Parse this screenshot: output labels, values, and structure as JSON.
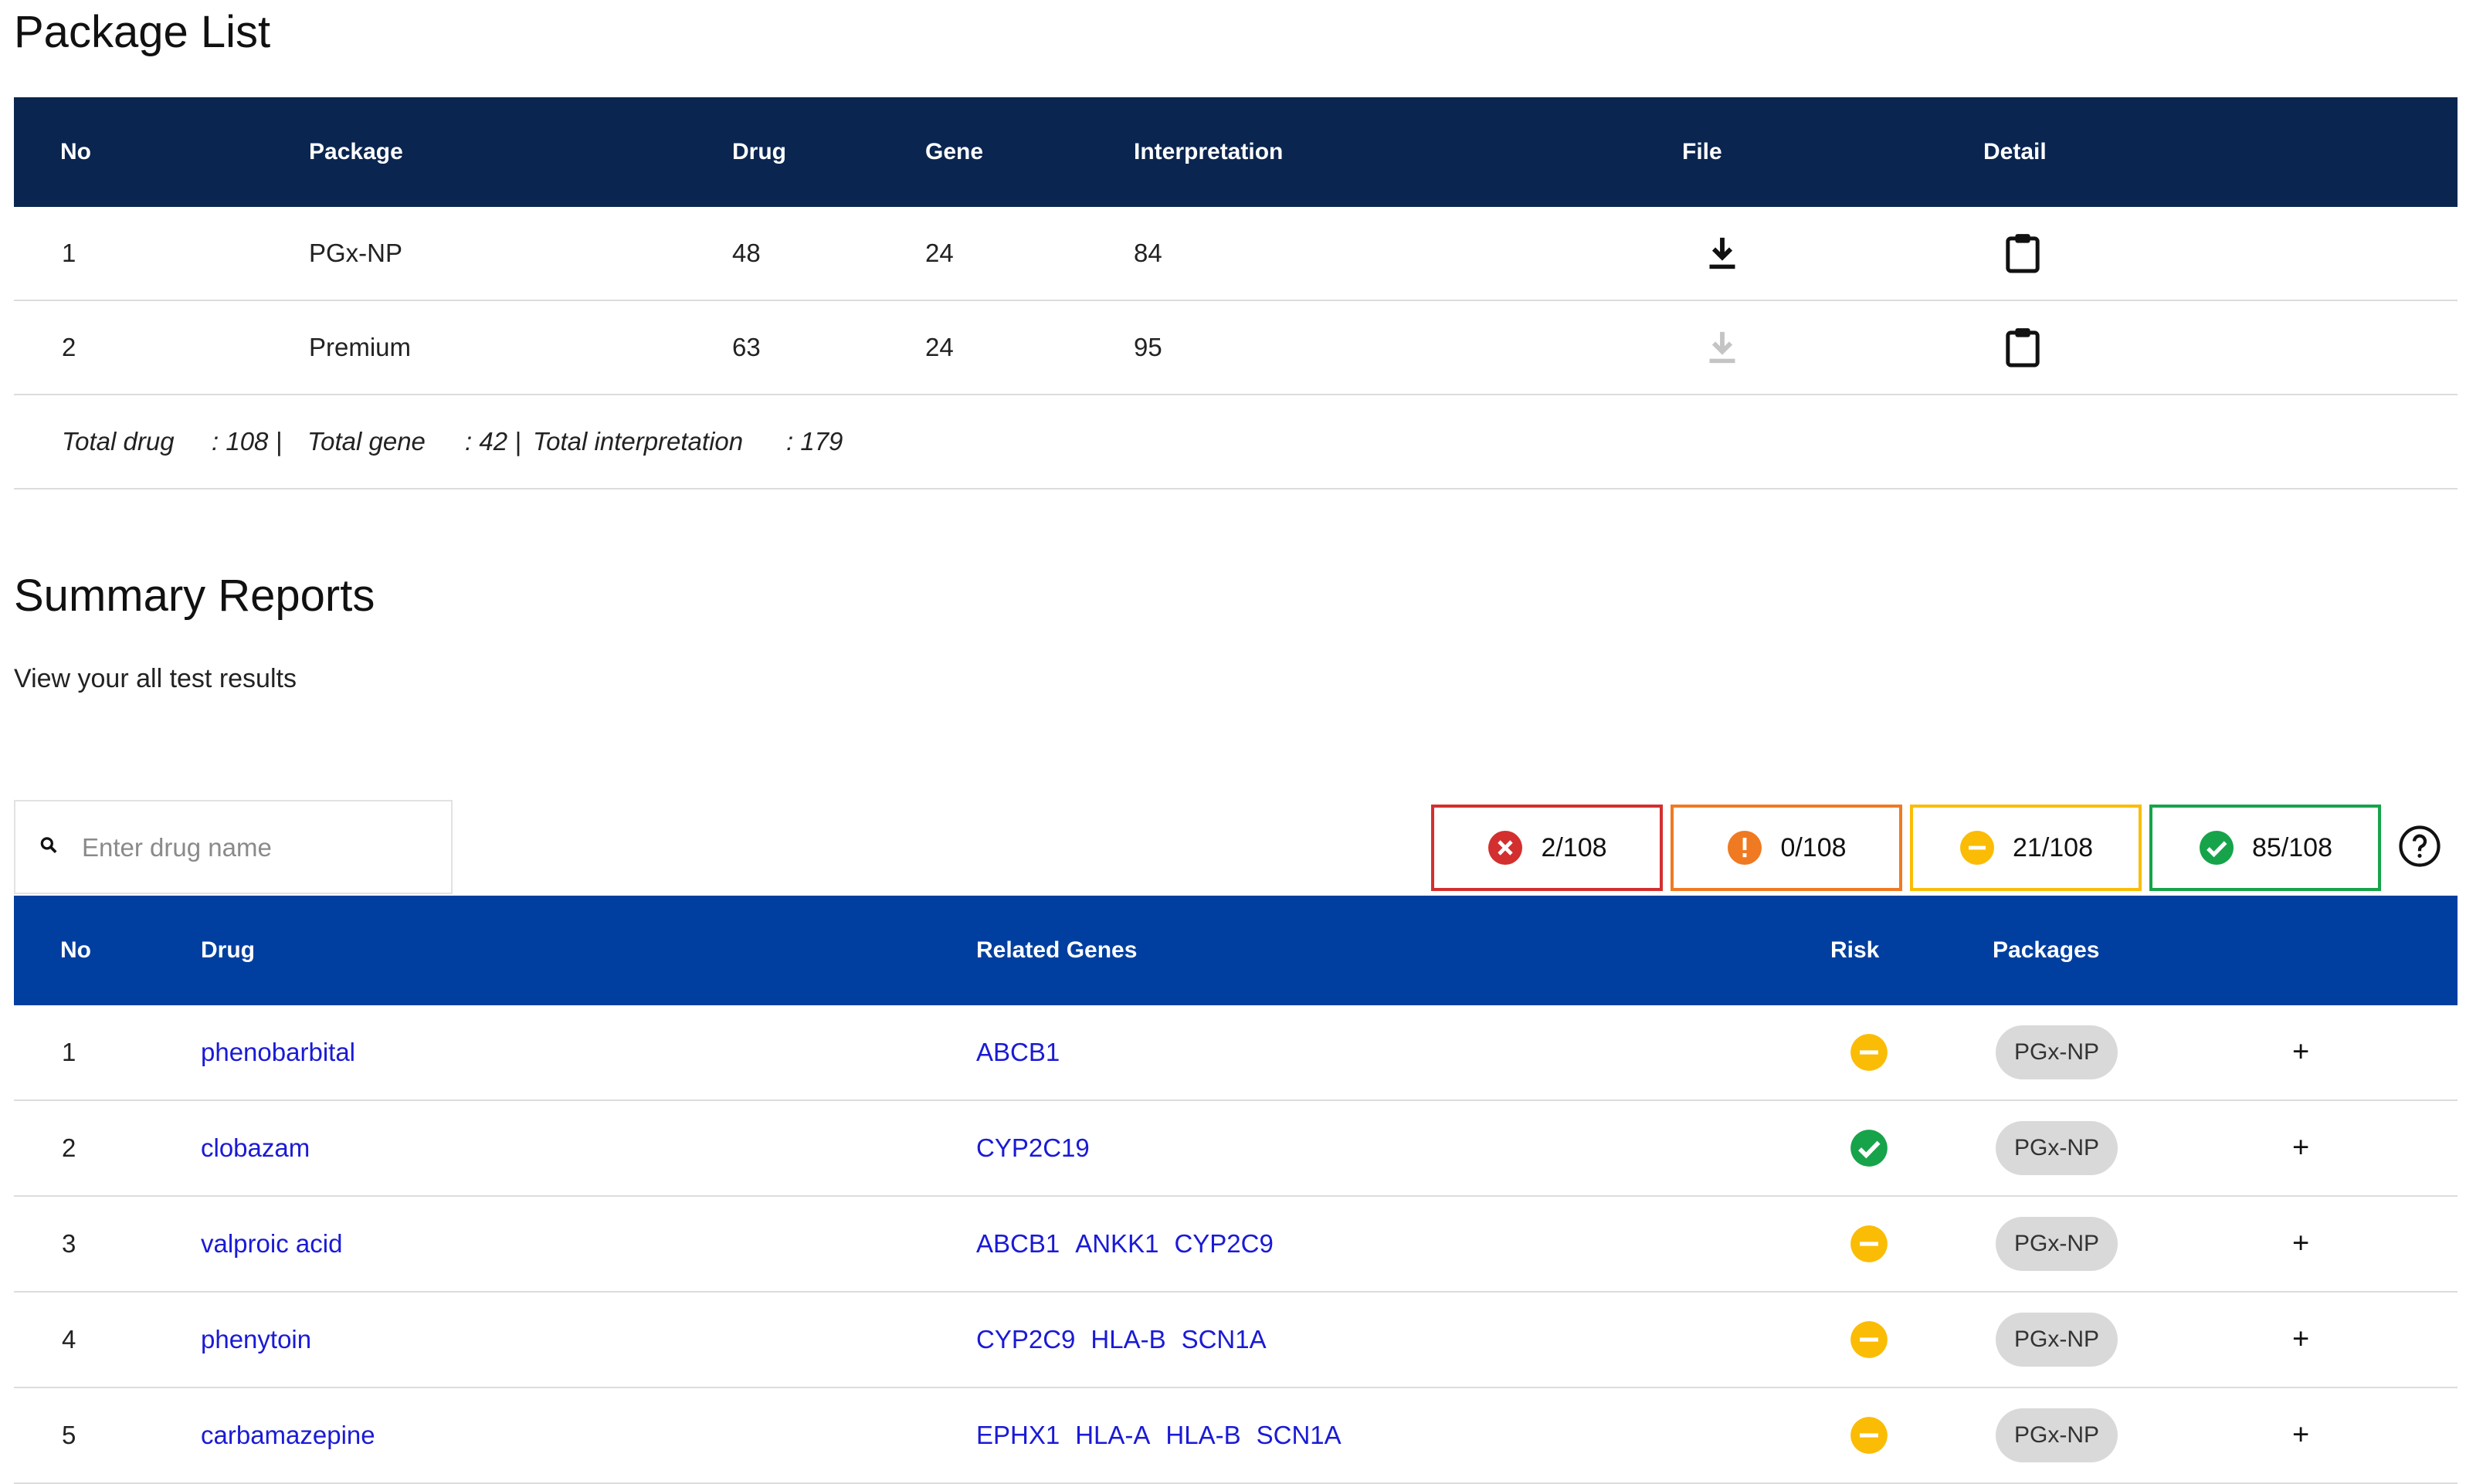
{
  "package_list": {
    "title": "Package List",
    "headers": [
      "No",
      "Package",
      "Drug",
      "Gene",
      "Interpretation",
      "File",
      "Detail"
    ],
    "rows": [
      {
        "no": "1",
        "package": "PGx-NP",
        "drug": "48",
        "gene": "24",
        "interpretation": "84",
        "file_enabled": true
      },
      {
        "no": "2",
        "package": "Premium",
        "drug": "63",
        "gene": "24",
        "interpretation": "95",
        "file_enabled": false
      }
    ],
    "totals": {
      "drug_label": "Total drug",
      "drug_value": ": 108 |",
      "gene_label": "Total gene",
      "gene_value": ": 42 |",
      "interp_label": "Total interpretation",
      "interp_value": ": 179"
    }
  },
  "summary": {
    "title": "Summary Reports",
    "subtitle": "View your all test results",
    "search": {
      "placeholder": "Enter drug name",
      "value": ""
    },
    "counters": [
      {
        "label": "2/108",
        "icon": "x-circle-icon",
        "color": "#d32f2f"
      },
      {
        "label": "0/108",
        "icon": "exclamation-circle-icon",
        "color": "#ef7a22"
      },
      {
        "label": "21/108",
        "icon": "minus-circle-icon",
        "color": "#fbbc05"
      },
      {
        "label": "85/108",
        "icon": "check-circle-icon",
        "color": "#17a34a"
      }
    ],
    "headers": [
      "No",
      "Drug",
      "Related Genes",
      "Risk",
      "Packages"
    ],
    "rows": [
      {
        "no": "1",
        "drug": "phenobarbital",
        "genes": [
          "ABCB1"
        ],
        "risk": "caution",
        "package": "PGx-NP"
      },
      {
        "no": "2",
        "drug": "clobazam",
        "genes": [
          "CYP2C19"
        ],
        "risk": "normal",
        "package": "PGx-NP"
      },
      {
        "no": "3",
        "drug": "valproic acid",
        "genes": [
          "ABCB1",
          "ANKK1",
          "CYP2C9"
        ],
        "risk": "caution",
        "package": "PGx-NP"
      },
      {
        "no": "4",
        "drug": "phenytoin",
        "genes": [
          "CYP2C9",
          "HLA-B",
          "SCN1A"
        ],
        "risk": "caution",
        "package": "PGx-NP"
      },
      {
        "no": "5",
        "drug": "carbamazepine",
        "genes": [
          "EPHX1",
          "HLA-A",
          "HLA-B",
          "SCN1A"
        ],
        "risk": "caution",
        "package": "PGx-NP"
      }
    ],
    "expand_label": "+"
  },
  "colors": {
    "package_header": "#0a2550",
    "report_header": "#003f9f",
    "link": "#1a1ad6",
    "caution": "#fbbc05",
    "normal": "#17a34a"
  }
}
